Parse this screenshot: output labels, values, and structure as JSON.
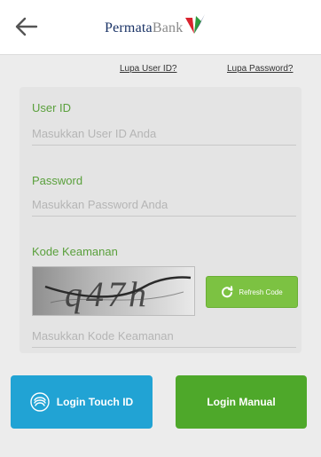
{
  "header": {
    "logo_name": "Permata",
    "logo_bank": "Bank",
    "icons": {
      "back": "arrow-left-icon",
      "logo": "permata-logo-mark"
    },
    "colors": {
      "logo_red": "#d9232e",
      "logo_green": "#2e9a3e",
      "logo_navy": "#1a3366"
    }
  },
  "links": {
    "forgot_user": "Lupa User ID?",
    "forgot_password": "Lupa Password?"
  },
  "form": {
    "user_id": {
      "label": "User ID",
      "placeholder": "Masukkan User ID Anda",
      "value": ""
    },
    "password": {
      "label": "Password",
      "placeholder": "Masukkan Password Anda",
      "value": ""
    },
    "security": {
      "label": "Kode Keamanan",
      "placeholder": "Masukkan Kode Keamanan",
      "value": "",
      "captcha_text": "q47h",
      "refresh_label": "Refresh Code",
      "refresh_icon": "refresh-icon"
    }
  },
  "buttons": {
    "touch_id": "Login Touch ID",
    "touch_icon": "fingerprint-icon",
    "manual": "Login Manual"
  },
  "colors": {
    "accent_green": "#5aa03c",
    "touch_blue": "#21a3d4",
    "manual_green": "#4ea82a",
    "refresh_green": "#7cc242"
  }
}
